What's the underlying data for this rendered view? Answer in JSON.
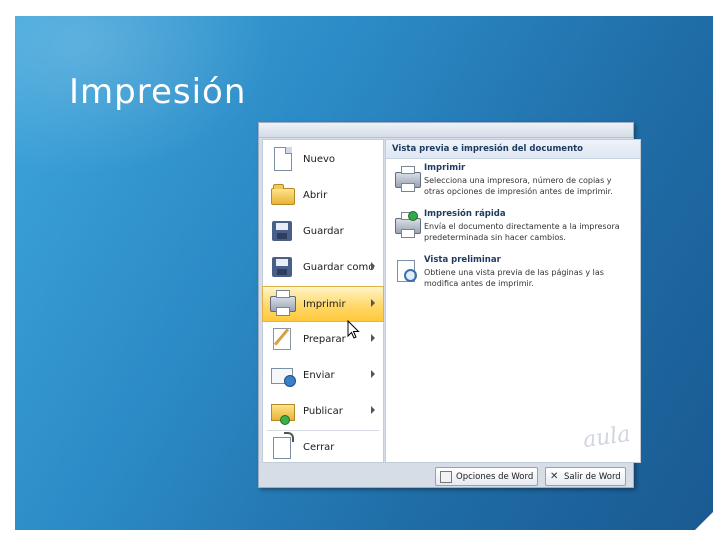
{
  "slide": {
    "title": "Impresión"
  },
  "menu": {
    "items": [
      {
        "label": "Nuevo",
        "icon": "new-document-icon",
        "submenu": false
      },
      {
        "label": "Abrir",
        "icon": "open-folder-icon",
        "submenu": false
      },
      {
        "label": "Guardar",
        "icon": "save-disk-icon",
        "submenu": false
      },
      {
        "label": "Guardar como",
        "icon": "save-as-icon",
        "submenu": true
      },
      {
        "label": "Imprimir",
        "icon": "printer-icon",
        "submenu": true,
        "active": true
      },
      {
        "label": "Preparar",
        "icon": "prepare-icon",
        "submenu": true
      },
      {
        "label": "Enviar",
        "icon": "send-icon",
        "submenu": true
      },
      {
        "label": "Publicar",
        "icon": "publish-icon",
        "submenu": true
      },
      {
        "label": "Cerrar",
        "icon": "close-document-icon",
        "submenu": false
      }
    ],
    "panel_title": "Vista previa e impresión del documento",
    "options": [
      {
        "title": "Imprimir",
        "description": "Selecciona una impresora, número de copias y otras opciones de impresión antes de imprimir.",
        "icon": "printer-icon"
      },
      {
        "title": "Impresión rápida",
        "description": "Envía el documento directamente a la impresora predeterminada sin hacer cambios.",
        "icon": "quick-print-icon"
      },
      {
        "title": "Vista preliminar",
        "description": "Obtiene una vista previa de las páginas y las modifica antes de imprimir.",
        "icon": "print-preview-icon"
      }
    ],
    "buttons": {
      "options": "Opciones de Word",
      "exit": "Salir de Word"
    },
    "watermark": "aula"
  }
}
